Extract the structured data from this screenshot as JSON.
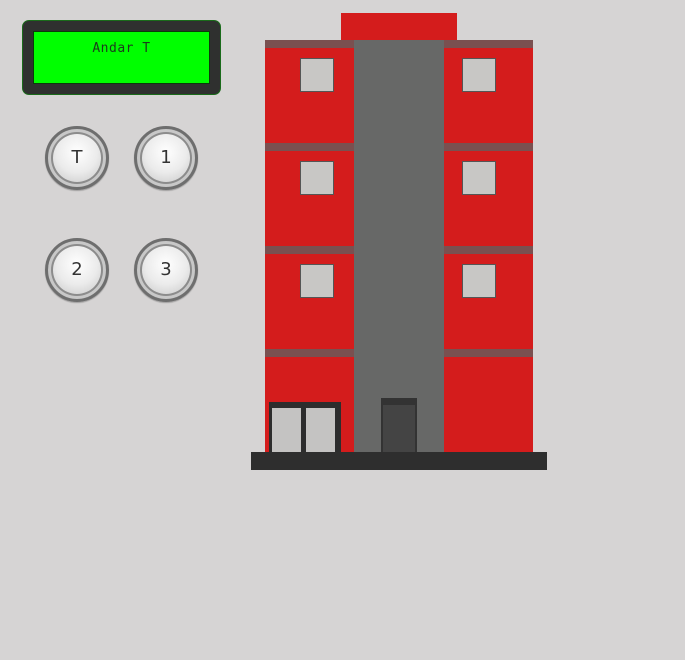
{
  "panel": {
    "display_text": "Andar T",
    "buttons": [
      {
        "label": "T"
      },
      {
        "label": "1"
      },
      {
        "label": "2"
      },
      {
        "label": "3"
      }
    ]
  },
  "colors": {
    "background": "#d6d4d4",
    "display_screen": "#00ff00",
    "building_red": "#d41c1c",
    "building_core": "#676867",
    "ledge": "#7a5050",
    "base": "#2e2e2e"
  }
}
